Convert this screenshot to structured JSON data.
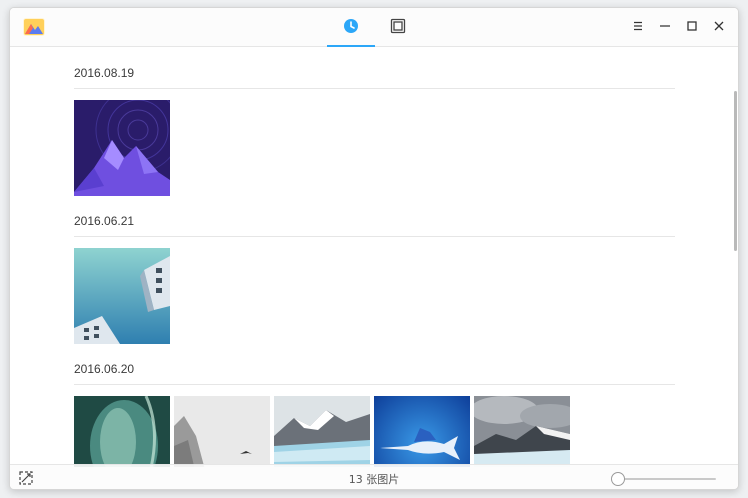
{
  "titlebar": {
    "app_icon": "deepin-album-icon",
    "tabs": [
      {
        "name": "timeline",
        "icon": "clock-icon",
        "active": true
      },
      {
        "name": "albums",
        "icon": "album-icon",
        "active": false
      }
    ],
    "window_buttons": [
      "menu-icon",
      "minimize-icon",
      "maximize-icon",
      "close-icon"
    ]
  },
  "groups": [
    {
      "date": "2016.08.19",
      "photos": [
        "purple-mountain-star-trails"
      ]
    },
    {
      "date": "2016.06.21",
      "photos": [
        "building-against-blue-sky"
      ]
    },
    {
      "date": "2016.06.20",
      "photos": [
        "green-abstract-glass",
        "misty-cliff-bird",
        "glacier-mountains",
        "blue-sailfish",
        "cloudy-glacier"
      ]
    }
  ],
  "statusbar": {
    "count_text": "13 张图片",
    "import_icon": "import-icon",
    "zoom_level": 0
  },
  "colors": {
    "accent": "#2ca7f8",
    "divider": "#e6e6e6",
    "background": "#ffffff"
  }
}
